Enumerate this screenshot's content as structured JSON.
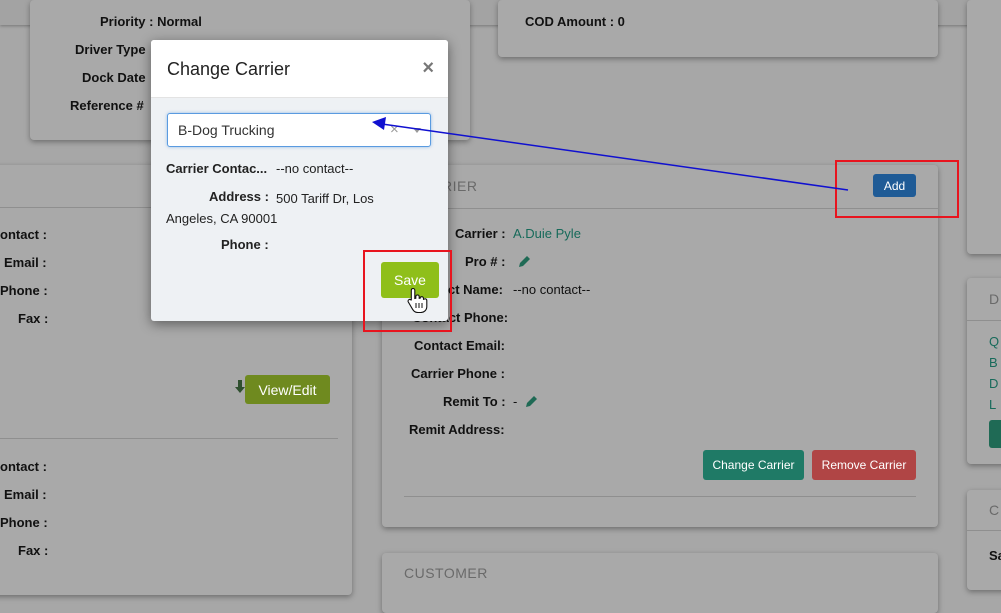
{
  "background": {
    "top_left_panel": {
      "top_line": "Priority : Normal",
      "fields": [
        "Driver Type",
        "Dock Date",
        "Reference #"
      ]
    },
    "top_mid_panel": {
      "top_line": "COD Amount : 0"
    },
    "left_panel": {
      "group1": [
        "ontact :",
        "Email :",
        "Phone :",
        "Fax :"
      ],
      "view_edit_label": "View/Edit",
      "group2": [
        "ontact :",
        "Email :",
        "Phone :",
        "Fax :"
      ]
    },
    "carrier_panel": {
      "header": "RIER",
      "add_label": "Add",
      "carrier_label": "Carrier :",
      "carrier_value": "A.Duie Pyle",
      "pro_label": "Pro # :",
      "contact_name_label": "ct Name:",
      "contact_name_value": "--no contact--",
      "contact_phone_label": "Contact Phone:",
      "contact_email_label": "Contact Email:",
      "carrier_phone_label": "Carrier Phone :",
      "remit_to_label": "Remit To :",
      "remit_to_value": "-",
      "remit_address_label": "Remit Address:",
      "change_carrier_label": "Change Carrier",
      "remove_carrier_label": "Remove Carrier"
    },
    "customer_panel": {
      "header": "CUSTOMER"
    },
    "right_panel": {
      "header": "D",
      "links": [
        "Q",
        "B",
        "D",
        "L"
      ],
      "lower_header": "C",
      "lower_label": "Sa"
    }
  },
  "modal": {
    "title": "Change Carrier",
    "close_glyph": "×",
    "carrier_input_value": "B-Dog Trucking",
    "clear_glyph": "×",
    "carrier_contact_label": "Carrier Contac...",
    "carrier_contact_value": "--no contact--",
    "address_label": "Address :",
    "address_value": "500 Tariff Dr, Los Angeles, CA 90001",
    "phone_label": "Phone :",
    "save_label": "Save"
  },
  "colors": {
    "save": "#8fbf1a",
    "add": "#1f5b96",
    "change_carrier": "#1f7a66",
    "remove_carrier": "#b04545",
    "annotation_red": "#e8141e",
    "annotation_arrow": "#1010d0"
  },
  "icons": [
    "pencil-icon",
    "download-arrow-icon",
    "hand-cursor-icon",
    "chevron-down-icon",
    "close-icon"
  ]
}
